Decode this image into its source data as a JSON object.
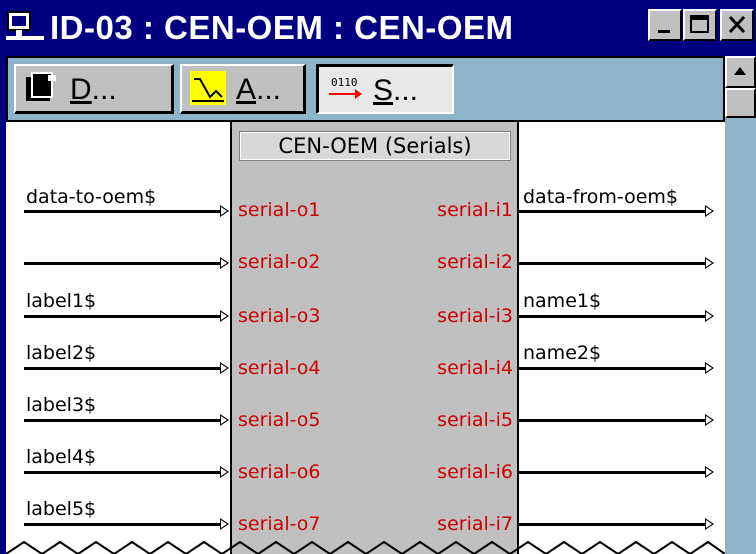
{
  "window": {
    "title": "ID-03 : CEN-OEM : CEN-OEM",
    "controls": [
      "minimize",
      "maximize",
      "close"
    ]
  },
  "toolbar": {
    "buttons": [
      {
        "label_prefix": "D",
        "label_suffix": "...",
        "icon": "document-icon",
        "pressed": false
      },
      {
        "label_prefix": "A",
        "label_suffix": "...",
        "icon": "analog-icon",
        "pressed": false
      },
      {
        "label_prefix": "S",
        "label_suffix": "...",
        "icon": "serial-icon",
        "pressed": true
      }
    ]
  },
  "block": {
    "title": "CEN-OEM (Serials)",
    "outputs": [
      "serial-o1",
      "serial-o2",
      "serial-o3",
      "serial-o4",
      "serial-o5",
      "serial-o6",
      "serial-o7"
    ],
    "inputs": [
      "serial-i1",
      "serial-i2",
      "serial-i3",
      "serial-i4",
      "serial-i5",
      "serial-i6",
      "serial-i7"
    ]
  },
  "left_signals": [
    "data-to-oem$",
    "",
    "label1$",
    "label2$",
    "label3$",
    "label4$",
    "label5$"
  ],
  "right_signals": [
    "data-from-oem$",
    "",
    "name1$",
    "name2$",
    "",
    "",
    ""
  ],
  "colors": {
    "title_bar": "#000080",
    "toolbar_bg": "#8fb3c8",
    "port_text": "#cc0000",
    "block_bg": "#c0c0c0"
  }
}
